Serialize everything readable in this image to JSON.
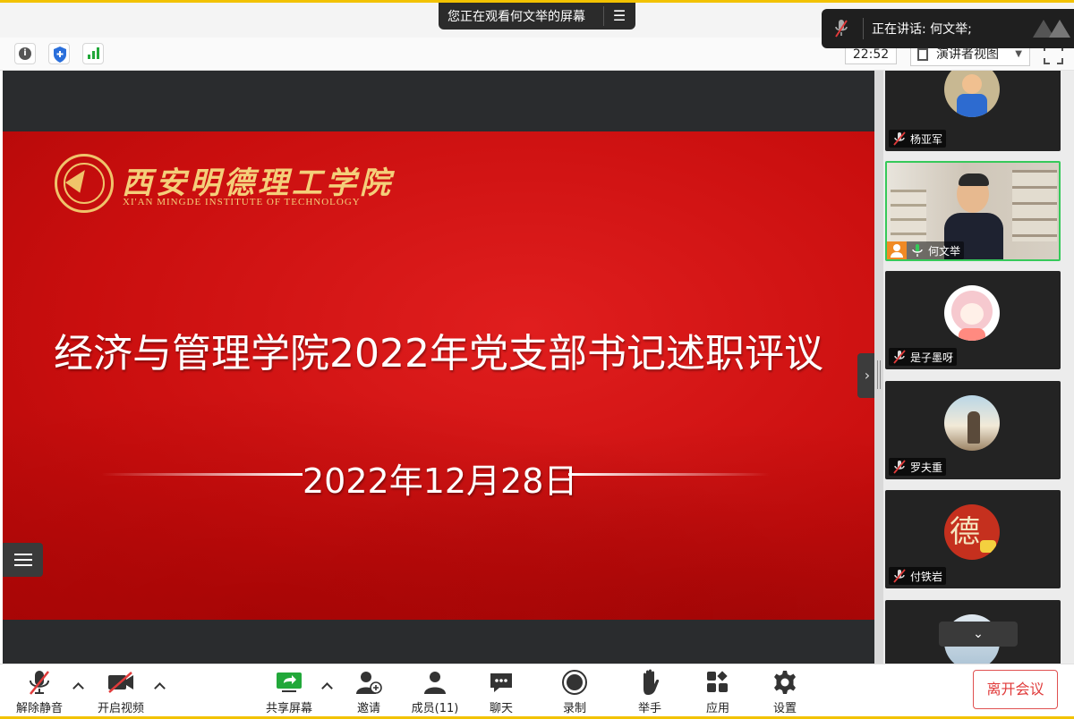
{
  "banner": {
    "viewing_text": "您正在观看何文举的屏幕",
    "options_icon": "options-icon"
  },
  "speaking_toast": {
    "text": "正在讲话: 何文举;"
  },
  "infobar": {
    "timer": "22:52",
    "view_mode": "演讲者视图"
  },
  "slide": {
    "school_name_cn": "西安明德理工学院",
    "school_name_en": "XI'AN MINGDE INSTITUTE OF TECHNOLOGY",
    "title": "经济与管理学院2022年党支部书记述职评议",
    "date": "2022年12月28日"
  },
  "gallery": {
    "participants": [
      {
        "name": "杨亚军",
        "muted": true
      },
      {
        "name": "何文举",
        "muted": false,
        "speaking": true
      },
      {
        "name": "是子墨呀",
        "muted": true
      },
      {
        "name": "罗夫重",
        "muted": true
      },
      {
        "name": "付铁岩",
        "muted": true
      }
    ]
  },
  "toolbar": {
    "unmute": "解除静音",
    "start_video": "开启视频",
    "share_screen": "共享屏幕",
    "invite": "邀请",
    "participants": "成员(11)",
    "chat": "聊天",
    "record": "录制",
    "raise_hand": "举手",
    "apps": "应用",
    "settings": "设置",
    "leave": "离开会议"
  },
  "colors": {
    "accent_green": "#36c95a",
    "leave_red": "#e03a3a",
    "slide_red": "#d01010",
    "logo_gold": "#f4cf7a"
  }
}
